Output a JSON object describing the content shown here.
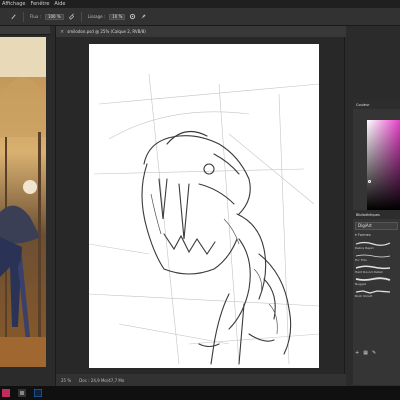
{
  "menubar": {
    "items": [
      "Affichage",
      "Fenêtre",
      "Aide"
    ]
  },
  "options": {
    "flow_label": "Flux :",
    "flow_value": "100 %",
    "smoothing_label": "Lissage :",
    "smoothing_value": "10 %"
  },
  "document": {
    "tab_close": "×",
    "tab_title": "smilodon.psd @ 25% (Calque 2, RVB/8)",
    "zoom": "25 %",
    "doc_info": "Doc : 24,9 Mo/47,7 Mo"
  },
  "panels": {
    "color_tab": "Couleur",
    "libraries_tab": "Bibliothèques",
    "library_name": "DigiArt",
    "group_label": "▾ Formes",
    "brushes": [
      "Debra Rapid",
      "Fur Thin",
      "Hard Round Detail",
      "Nugget",
      "Rock Smart"
    ],
    "footer_icons": [
      "+",
      "▦",
      "✎"
    ]
  },
  "colors": {
    "accent": "#2d8ceb",
    "picker_hue": "#e640c8"
  }
}
